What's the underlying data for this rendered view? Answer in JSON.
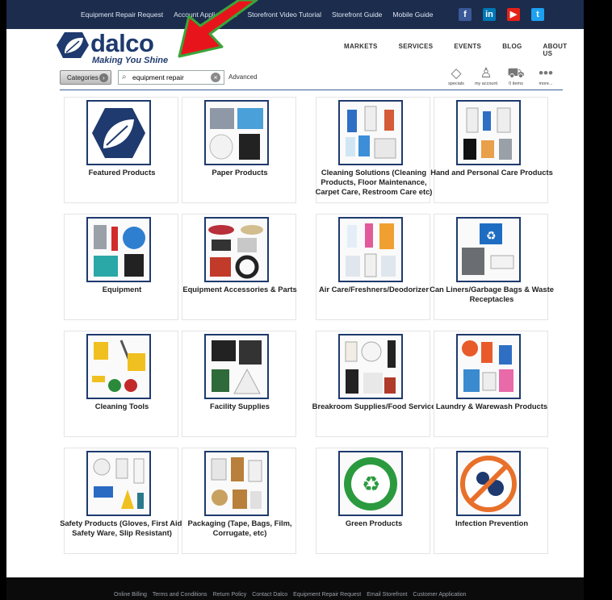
{
  "topbar": {
    "links": [
      "Equipment Repair Request",
      "Account Applications",
      "Storefront Video Tutorial",
      "Storefront Guide",
      "Mobile Guide"
    ],
    "social": [
      {
        "icon": "facebook-icon",
        "glyph": "f",
        "color": "#3b5998"
      },
      {
        "icon": "linkedin-icon",
        "glyph": "in",
        "color": "#0077b5"
      },
      {
        "icon": "youtube-icon",
        "glyph": "▶",
        "color": "#e62117"
      },
      {
        "icon": "twitter-icon",
        "glyph": "t",
        "color": "#1da1f2"
      }
    ]
  },
  "logo": {
    "name": "dalco",
    "tagline": "Making You Shine"
  },
  "nav": [
    "MARKETS",
    "SERVICES",
    "EVENTS",
    "BLOG",
    "ABOUT US"
  ],
  "search": {
    "categories_label": "Categories",
    "value": "equipment repair",
    "advanced_label": "Advanced"
  },
  "header_icons": [
    {
      "label": "specials",
      "icon": "tag-icon",
      "glyph": "◇"
    },
    {
      "label": "my account",
      "icon": "user-icon",
      "glyph": "♙"
    },
    {
      "label": "0 items",
      "icon": "cart-icon",
      "glyph": "⛟"
    },
    {
      "label": "more...",
      "icon": "more-icon",
      "glyph": "•••"
    }
  ],
  "categories": [
    {
      "label": "Featured Products",
      "icon": "featured-products-image"
    },
    {
      "label": "Paper Products",
      "icon": "paper-products-image"
    },
    {
      "label": "Cleaning Solutions (Cleaning Products, Floor Maintenance, Carpet Care, Restroom Care etc)",
      "icon": "cleaning-solutions-image"
    },
    {
      "label": "Hand and Personal Care Products",
      "icon": "hand-care-image"
    },
    {
      "label": "Equipment",
      "icon": "equipment-image"
    },
    {
      "label": "Equipment Accessories & Parts",
      "icon": "equipment-parts-image"
    },
    {
      "label": "Air Care/Freshners/Deodorizer",
      "icon": "air-care-image"
    },
    {
      "label": "Can Liners/Garbage Bags & Waste Receptacles",
      "icon": "can-liners-image"
    },
    {
      "label": "Cleaning Tools",
      "icon": "cleaning-tools-image"
    },
    {
      "label": "Facility Supplies",
      "icon": "facility-supplies-image"
    },
    {
      "label": "Breakroom Supplies/Food Service",
      "icon": "breakroom-image"
    },
    {
      "label": "Laundry & Warewash Products",
      "icon": "laundry-image"
    },
    {
      "label": "Safety Products (Gloves, First Aid, Safety Ware, Slip Resistant)",
      "icon": "safety-products-image"
    },
    {
      "label": "Packaging (Tape, Bags, Film, Corrugate, etc)",
      "icon": "packaging-image"
    },
    {
      "label": "Green Products",
      "icon": "green-products-image"
    },
    {
      "label": "Infection Prevention",
      "icon": "infection-prevention-image"
    }
  ],
  "footer": {
    "links": [
      "Online Billing",
      "Terms and Conditions",
      "Return Policy",
      "Contact Dalco",
      "Equipment Repair Request",
      "Email Storefront",
      "Customer Application"
    ]
  },
  "colors": {
    "navy": "#1e3a6e",
    "topbar": "#1c2c4c",
    "arrow_red": "#e8141b",
    "arrow_green": "#3aa53a"
  }
}
